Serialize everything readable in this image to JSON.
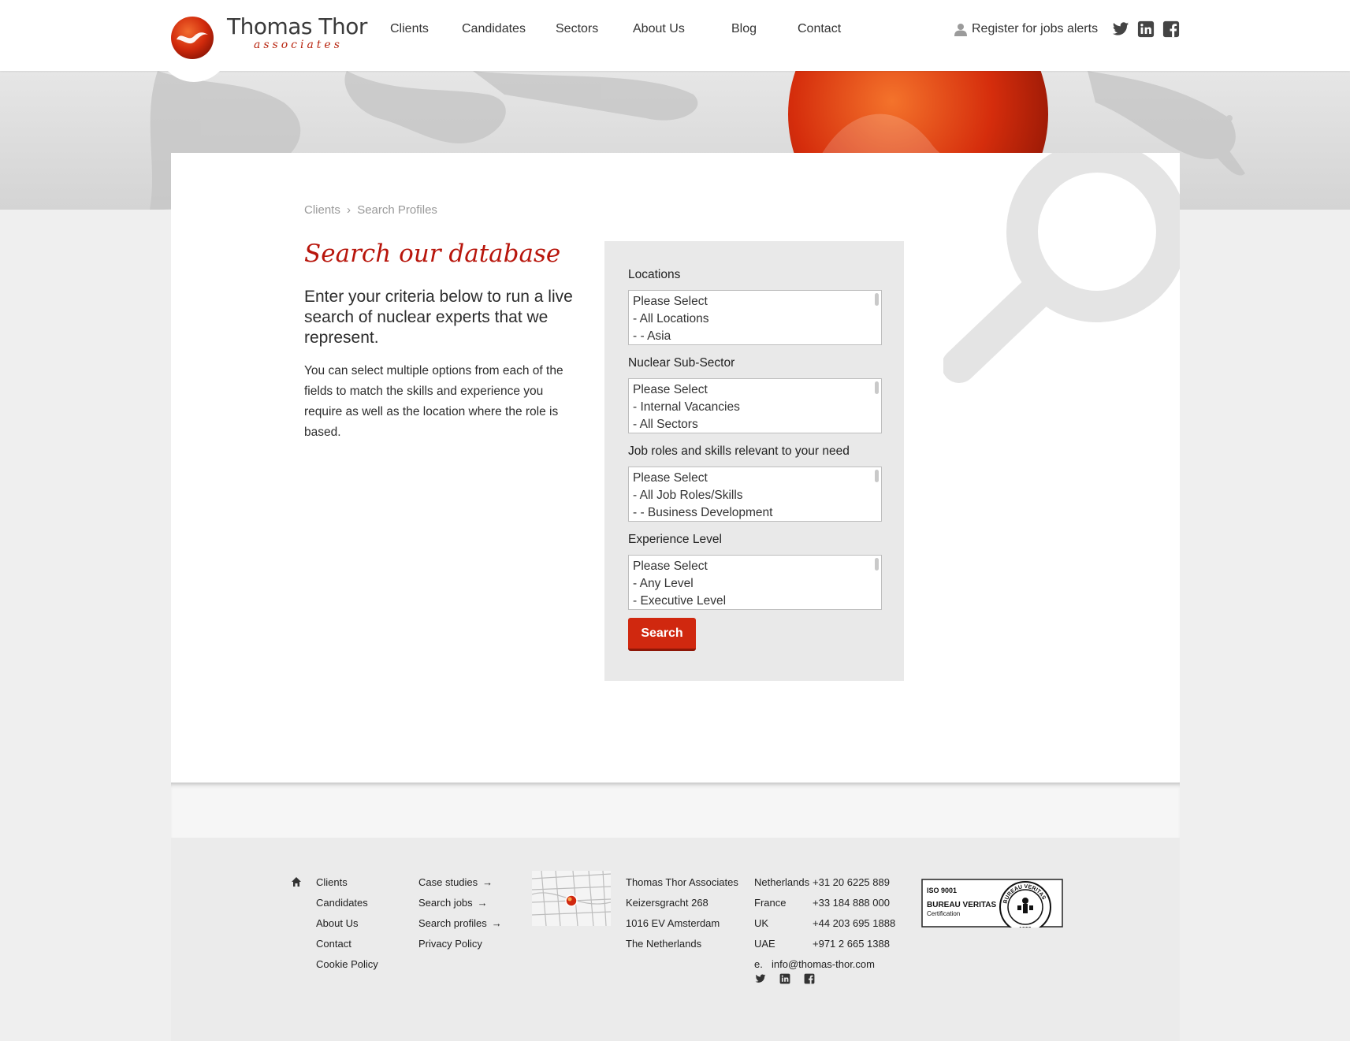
{
  "brand": {
    "name": "Thomas Thor",
    "sub": "associates",
    "accent": "#d0280f",
    "title_red": "#b8160c"
  },
  "nav": {
    "items": [
      {
        "label": "Clients"
      },
      {
        "label": "Candidates"
      },
      {
        "label": "Sectors"
      },
      {
        "label": "About Us"
      },
      {
        "label": "Blog"
      },
      {
        "label": "Contact"
      }
    ],
    "register_label": "Register for jobs alerts",
    "social_icons": [
      "twitter-icon",
      "linkedin-icon",
      "facebook-icon"
    ]
  },
  "breadcrumb": {
    "items": [
      "Clients",
      "Search Profiles"
    ],
    "separator": "›"
  },
  "main": {
    "title": "Search our database",
    "lead": "Enter your criteria below to run a live search of nuclear experts that we represent.",
    "body": "You can select multiple options from each of the fields to match the skills and experience you require as well as the location where the role is based."
  },
  "form": {
    "fields": [
      {
        "label": "Locations",
        "options": [
          "Please Select",
          "- All Locations",
          "- - Asia"
        ]
      },
      {
        "label": "Nuclear Sub-Sector",
        "options": [
          "Please Select",
          "- Internal Vacancies",
          "- All Sectors"
        ]
      },
      {
        "label": "Job roles and skills relevant to your need",
        "options": [
          "Please Select",
          "- All Job Roles/Skills",
          "- - Business Development"
        ]
      },
      {
        "label": "Experience Level",
        "options": [
          "Please Select",
          "- Any Level",
          "- Executive Level"
        ]
      }
    ],
    "search_label": "Search"
  },
  "footer": {
    "col1": [
      "Clients",
      "Candidates",
      "About Us",
      "Contact",
      "Cookie Policy"
    ],
    "col2": [
      "Case studies",
      "Search jobs",
      "Search profiles",
      "Privacy Policy"
    ],
    "arrow": "→",
    "address": [
      "Thomas Thor Associates",
      "Keizersgracht 268",
      "1016 EV Amsterdam",
      "The Netherlands"
    ],
    "phones": [
      {
        "country": "Netherlands",
        "number": "+31 20 6225 889"
      },
      {
        "country": "France",
        "number": "+33 184 888 000"
      },
      {
        "country": "UK",
        "number": "+44 203 695 1888"
      },
      {
        "country": "UAE",
        "number": "+971 2 665 1388"
      }
    ],
    "email_prefix": "e.",
    "email": "info@thomas-thor.com",
    "iso": {
      "line1": "ISO 9001",
      "line2": "BUREAU VERITAS",
      "line3": "Certification",
      "year": "1828",
      "ring": "BUREAU VERITAS"
    }
  }
}
